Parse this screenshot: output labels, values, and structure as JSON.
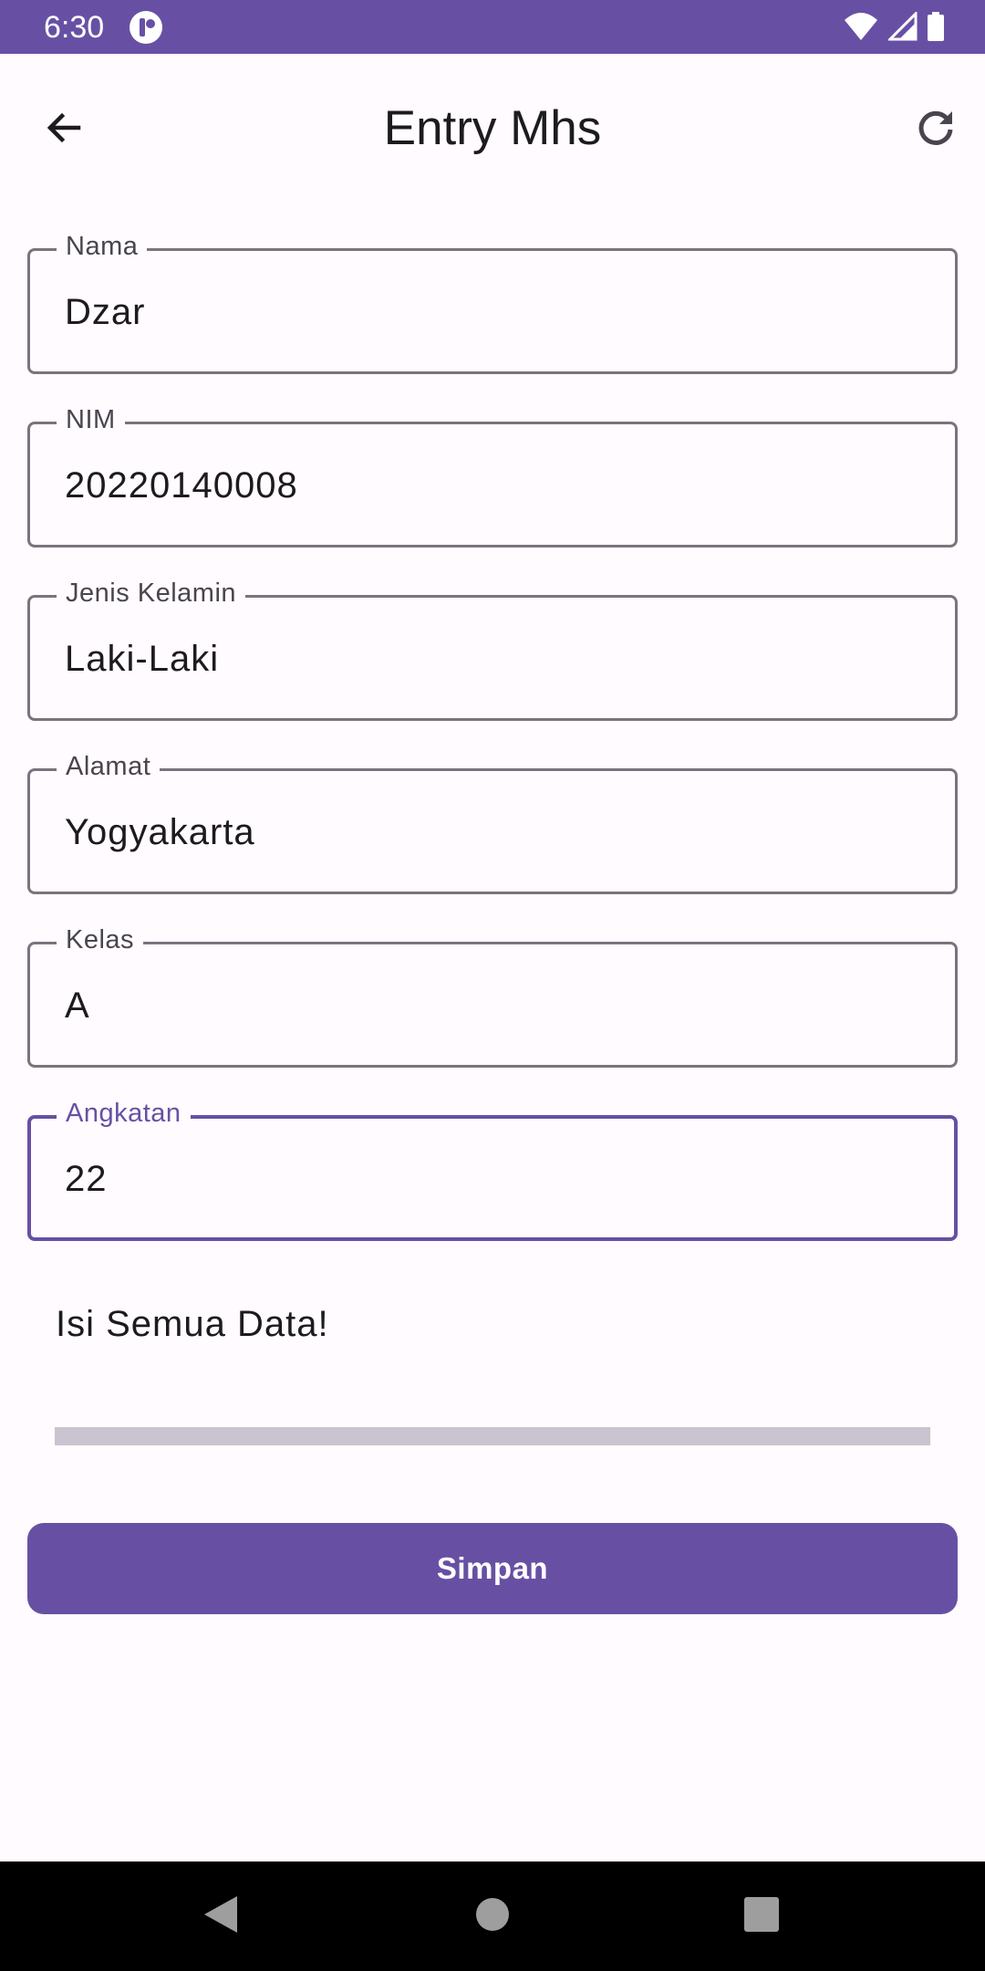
{
  "status_bar": {
    "time": "6:30",
    "app_icon": "app-notification-icon",
    "icons": [
      "wifi-icon",
      "signal-icon",
      "battery-icon"
    ],
    "background": "#6750A4"
  },
  "app_bar": {
    "title": "Entry Mhs",
    "back_icon": "arrow-back-icon",
    "refresh_icon": "refresh-icon"
  },
  "form": {
    "fields": [
      {
        "label": "Nama",
        "value": "Dzar"
      },
      {
        "label": "NIM",
        "value": "20220140008"
      },
      {
        "label": "Jenis Kelamin",
        "value": "Laki-Laki"
      },
      {
        "label": "Alamat",
        "value": "Yogyakarta"
      },
      {
        "label": "Kelas",
        "value": "A"
      },
      {
        "label": "Angkatan",
        "value": "22",
        "focused": true
      }
    ],
    "message": "Isi Semua Data!",
    "submit_label": "Simpan"
  },
  "nav_bar": {
    "buttons": [
      "back-triangle-icon",
      "home-circle-icon",
      "recents-square-icon"
    ]
  },
  "colors": {
    "primary": "#6750A4",
    "outline": "#79747E",
    "background": "#FFFBFE",
    "divider": "#CAC4D0"
  }
}
